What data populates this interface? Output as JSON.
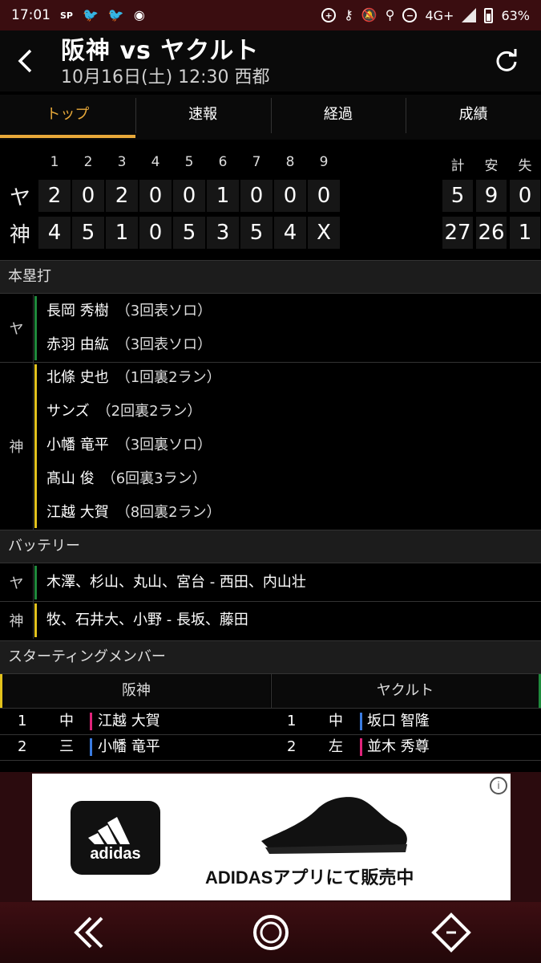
{
  "status_bar": {
    "time": "17:01",
    "network": "4G+",
    "battery": "63%"
  },
  "header": {
    "title": "阪神 vs ヤクルト",
    "subtitle": "10月16日(土) 12:30 西都"
  },
  "tabs": [
    {
      "label": "トップ",
      "active": true
    },
    {
      "label": "速報"
    },
    {
      "label": "経過"
    },
    {
      "label": "成績"
    }
  ],
  "scoreboard": {
    "innings": [
      "1",
      "2",
      "3",
      "4",
      "5",
      "6",
      "7",
      "8",
      "9"
    ],
    "totals_headers": [
      "計",
      "安",
      "失"
    ],
    "teams": [
      {
        "label": "ヤ",
        "scores": [
          "2",
          "0",
          "2",
          "0",
          "0",
          "1",
          "0",
          "0",
          "0"
        ],
        "totals": [
          "5",
          "9",
          "0"
        ]
      },
      {
        "label": "神",
        "scores": [
          "4",
          "5",
          "1",
          "0",
          "5",
          "3",
          "5",
          "4",
          "X"
        ],
        "totals": [
          "27",
          "26",
          "1"
        ]
      }
    ]
  },
  "homeruns": {
    "title": "本塁打",
    "teams": [
      {
        "label": "ヤ",
        "color": "#1f8a3c",
        "rows": [
          {
            "name": "長岡 秀樹",
            "detail": "（3回表ソロ）"
          },
          {
            "name": "赤羽 由紘",
            "detail": "（3回表ソロ）"
          }
        ]
      },
      {
        "label": "神",
        "color": "#e3c21c",
        "rows": [
          {
            "name": "北條 史也",
            "detail": "（1回裏2ラン）"
          },
          {
            "name": "サンズ",
            "detail": "（2回裏2ラン）"
          },
          {
            "name": "小幡 竜平",
            "detail": "（3回裏ソロ）"
          },
          {
            "name": "髙山 俊",
            "detail": "（6回裏3ラン）"
          },
          {
            "name": "江越 大賀",
            "detail": "（8回裏2ラン）"
          }
        ]
      }
    ]
  },
  "battery": {
    "title": "バッテリー",
    "teams": [
      {
        "label": "ヤ",
        "text": "木澤、杉山、丸山、宮台 - 西田、内山壮"
      },
      {
        "label": "神",
        "text": "牧、石井大、小野 - 長坂、藤田"
      }
    ]
  },
  "starting": {
    "title": "スターティングメンバー",
    "home": "阪神",
    "away": "ヤクルト",
    "rows": [
      {
        "home": {
          "order": "1",
          "pos": "中",
          "name": "江越 大賀",
          "color": "#e0237a"
        },
        "away": {
          "order": "1",
          "pos": "中",
          "name": "坂口 智隆",
          "color": "#3a7be0"
        }
      },
      {
        "home": {
          "order": "2",
          "pos": "三",
          "name": "小幡 竜平",
          "color": "#3a7be0"
        },
        "away": {
          "order": "2",
          "pos": "左",
          "name": "並木 秀尊",
          "color": "#e0237a"
        }
      }
    ]
  },
  "ad": {
    "logo_text": "adidas",
    "text": "ADIDASアプリにて販売中"
  }
}
